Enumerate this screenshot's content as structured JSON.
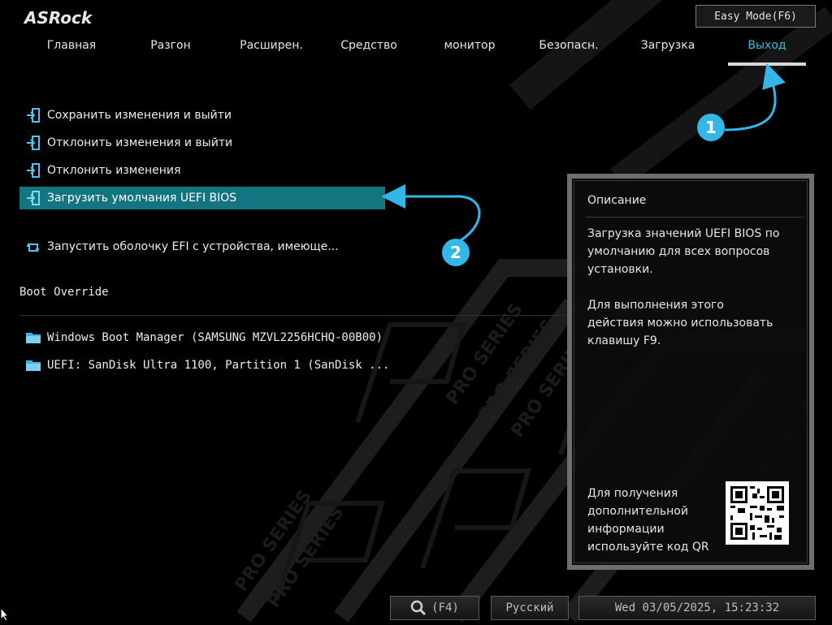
{
  "brand": {
    "logo_text": "ASRock"
  },
  "header": {
    "easy_mode_label": "Easy Mode(F6)"
  },
  "tabs": [
    {
      "label": "Главная",
      "active": false
    },
    {
      "label": "Разгон",
      "active": false
    },
    {
      "label": "Расширен.",
      "active": false
    },
    {
      "label": "Средство",
      "active": false
    },
    {
      "label": "монитор",
      "active": false
    },
    {
      "label": "Безопасн.",
      "active": false
    },
    {
      "label": "Загрузка",
      "active": false
    },
    {
      "label": "Выход",
      "active": true
    }
  ],
  "exit_menu": [
    {
      "label": "Сохранить изменения и выйти",
      "icon": "exit-door-icon"
    },
    {
      "label": "Отклонить изменения и выйти",
      "icon": "exit-door-icon"
    },
    {
      "label": "Отклонить изменения",
      "icon": "exit-door-icon"
    },
    {
      "label": "Загрузить умолчания UEFI BIOS",
      "icon": "exit-door-icon",
      "selected": true
    },
    {
      "label": "Запустить оболочку EFI с устройства, имеюще...",
      "icon": "refresh-arrows-icon"
    }
  ],
  "boot_override": {
    "title": "Boot Override",
    "items": [
      {
        "label": "Windows Boot Manager (SAMSUNG MZVL2256HCHQ-00B00)",
        "icon": "folder-icon"
      },
      {
        "label": "UEFI: SanDisk Ultra 1100, Partition 1 (SanDisk ...",
        "icon": "folder-icon"
      }
    ]
  },
  "description": {
    "title": "Описание",
    "lines_1": [
      "Загрузка значений UEFI BIOS по",
      "умолчанию для всех вопросов",
      "установки."
    ],
    "lines_2": [
      "Для выполнения этого",
      "действия можно использовать",
      "клавишу F9."
    ],
    "qr_note": [
      "Для получения",
      "дополнительной",
      "информации",
      "используйте код QR"
    ]
  },
  "callouts": {
    "one": "1",
    "two": "2"
  },
  "footer": {
    "search_label": "(F4)",
    "language_label": "Русский",
    "datetime": "Wed 03/05/2025, 15:23:32"
  },
  "colors": {
    "accent": "#33bde0",
    "selected_row": "#14747f",
    "callout": "#34b6e6"
  }
}
